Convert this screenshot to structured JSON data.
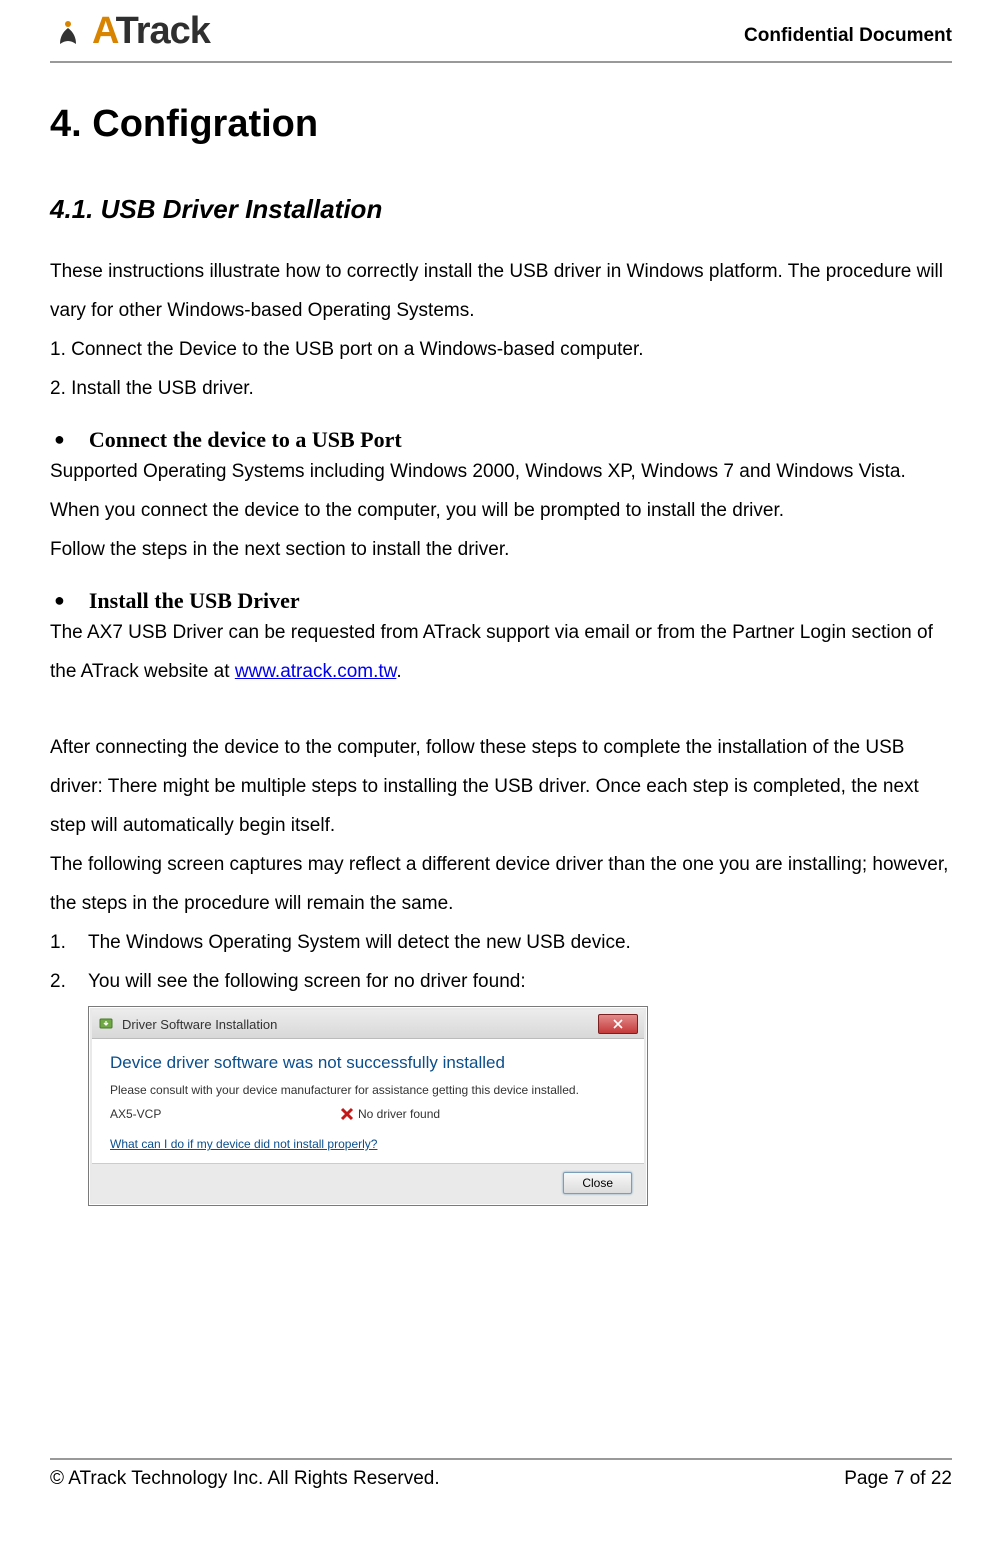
{
  "header": {
    "logo_text_before": "A",
    "logo_text_after": "Track",
    "confidential": "Confidential  Document"
  },
  "h1": "4. Configration",
  "h2": "4.1.  USB Driver Installation",
  "intro_p1": "These instructions illustrate how to correctly install the USB driver in Windows platform. The procedure will vary for other Windows-based Operating Systems.",
  "intro_step1": "1. Connect the Device to the USB port on a Windows-based computer.",
  "intro_step2": "2. Install the USB driver.",
  "bullet1_title": "Connect the device to a USB Port",
  "bullet1_p1": "Supported Operating Systems including Windows 2000, Windows XP, Windows 7 and Windows Vista. When you connect the device to the computer, you will be prompted to install the driver.",
  "bullet1_p2": "Follow the steps in the next section to install the driver.",
  "bullet2_title": "Install the USB Driver",
  "bullet2_p1_before": "The AX7 USB Driver can be requested from ATrack support via email or from the Partner Login section of the ATrack website at ",
  "bullet2_link": "www.atrack.com.tw",
  "bullet2_p1_after": ".",
  "bullet2_p2": "After connecting the device to the computer, follow these steps to complete the installation of the USB driver: There might be multiple steps to installing the USB driver. Once each step is completed, the next step will automatically begin itself.",
  "bullet2_p3": "The following screen captures may reflect a different device driver than the one you are installing; however, the steps in the procedure will remain the same.",
  "num_list": {
    "n1": "1.",
    "t1": "The Windows Operating System will detect the new USB device.",
    "n2": "2.",
    "t2": "You will see the following screen for no driver found:"
  },
  "screenshot": {
    "title": "Driver Software Installation",
    "heading": "Device driver software was not successfully installed",
    "sub": "Please consult with your device manufacturer for assistance getting this device installed.",
    "device_name": "AX5-VCP",
    "status": "No driver found",
    "help_link": "What can I do if my device did not install properly?",
    "close_label": "Close"
  },
  "footer": {
    "copyright": "© ATrack Technology Inc. All Rights Reserved.",
    "page": "Page 7 of 22"
  }
}
